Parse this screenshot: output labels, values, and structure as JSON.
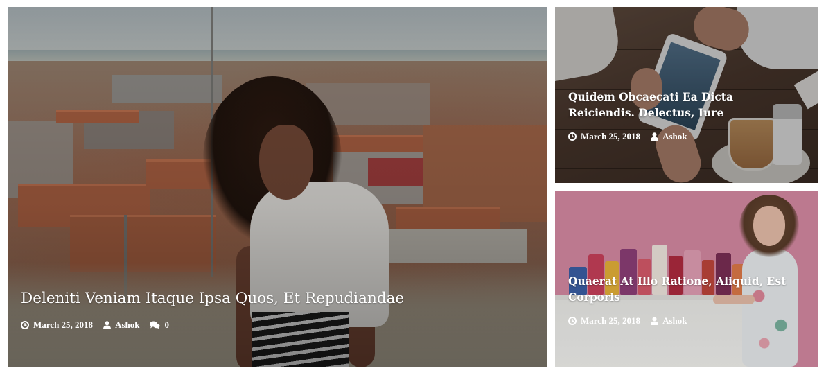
{
  "posts": [
    {
      "title": "Deleniti Veniam Itaque Ipsa Quos, Et Repudiandae",
      "date": "March 25, 2018",
      "author": "Ashok",
      "comments": "0"
    },
    {
      "title": "Quidem Obcaecati Ea Dicta Reiciendis. Delectus, Iure",
      "date": "March 25, 2018",
      "author": "Ashok"
    },
    {
      "title": "Quaerat At Illo Ratione, Aliquid, Est Corporis",
      "date": "March 25, 2018",
      "author": "Ashok"
    }
  ],
  "icons": {
    "date": "clock-icon",
    "author": "user-icon",
    "comments": "comments-icon"
  },
  "colors": {
    "text": "#ffffff",
    "background": "#ffffff"
  }
}
